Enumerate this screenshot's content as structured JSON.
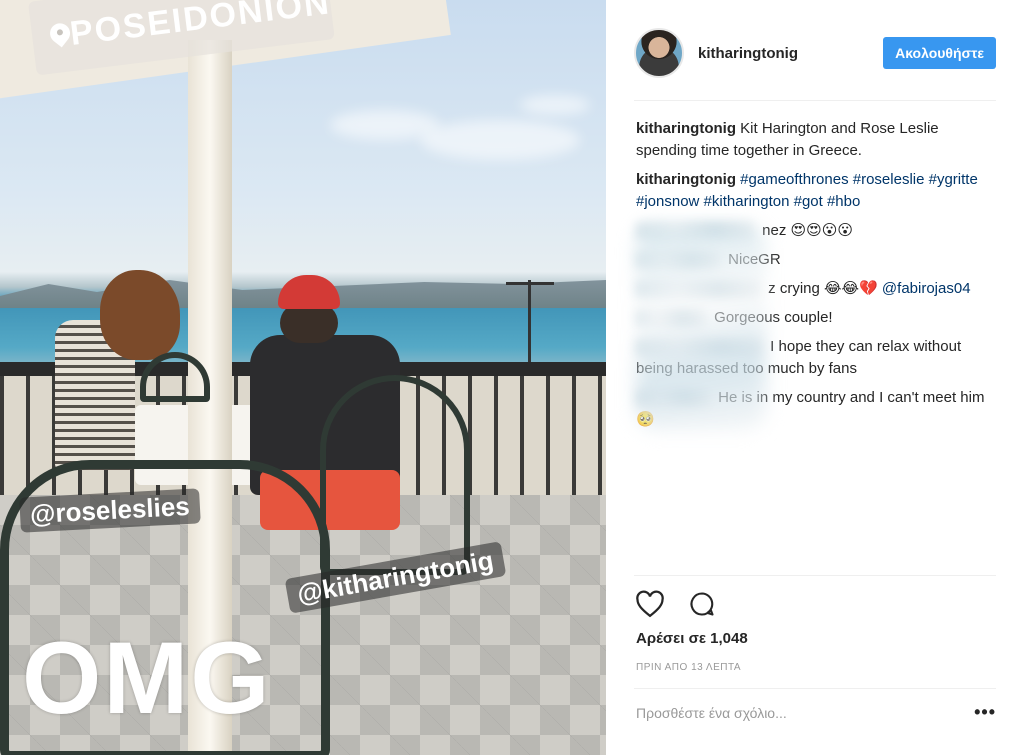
{
  "photo": {
    "location_sticker": "POSEIDONION",
    "mention_1": "@roseleslies",
    "mention_2": "@kitharingtonig",
    "overlay_text": "OMG"
  },
  "post": {
    "username": "kitharingtonig",
    "follow_label": "Ακολουθήστε",
    "caption": {
      "user": "kitharingtonig",
      "text": "Kit Harington and Rose Leslie spending time together in Greece."
    },
    "hashtags_comment": {
      "user": "kitharingtonig",
      "tags": "#gameofthrones #roseleslie #ygritte #jonsnow #kitharington #got #hbo"
    },
    "comments": [
      {
        "text": "nez 😍😍😮😮"
      },
      {
        "text": "NiceGR"
      },
      {
        "text": "z crying 😂😂💔",
        "mention": "@fabirojas04"
      },
      {
        "text": "Gorgeous couple!"
      },
      {
        "text": "I hope they can relax without being harassed too much by fans"
      },
      {
        "text": "He is in my country and I can't meet him 🥺"
      }
    ],
    "likes": "Αρέσει σε 1,048",
    "time": "ΠΡΙΝ ΑΠΟ 13 ΛΕΠΤΑ",
    "comment_placeholder": "Προσθέστε ένα σχόλιο...",
    "more_label": "•••"
  },
  "icons": {
    "like": "heart-icon",
    "comment": "comment-bubble-icon",
    "location": "location-pin-icon"
  },
  "colors": {
    "follow_button": "#3897f0",
    "hashtag": "#003569",
    "text": "#262626",
    "muted": "#999999"
  }
}
